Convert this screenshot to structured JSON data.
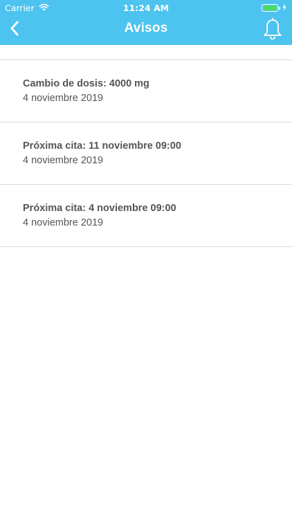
{
  "status_bar": {
    "carrier": "Carrier",
    "time": "11:24 AM",
    "battery_color": "#4cd964"
  },
  "nav": {
    "title": "Avisos",
    "back_icon": "chevron-left-icon",
    "right_icon": "bell-icon",
    "background": "#4dc3ef"
  },
  "notifications": [
    {
      "title": "Cambio de dosis: 4000 mg",
      "date": "4 noviembre 2019"
    },
    {
      "title": "Próxima cita: 11 noviembre 09:00",
      "date": "4 noviembre 2019"
    },
    {
      "title": "Próxima cita: 4 noviembre 09:00",
      "date": "4 noviembre 2019"
    }
  ]
}
